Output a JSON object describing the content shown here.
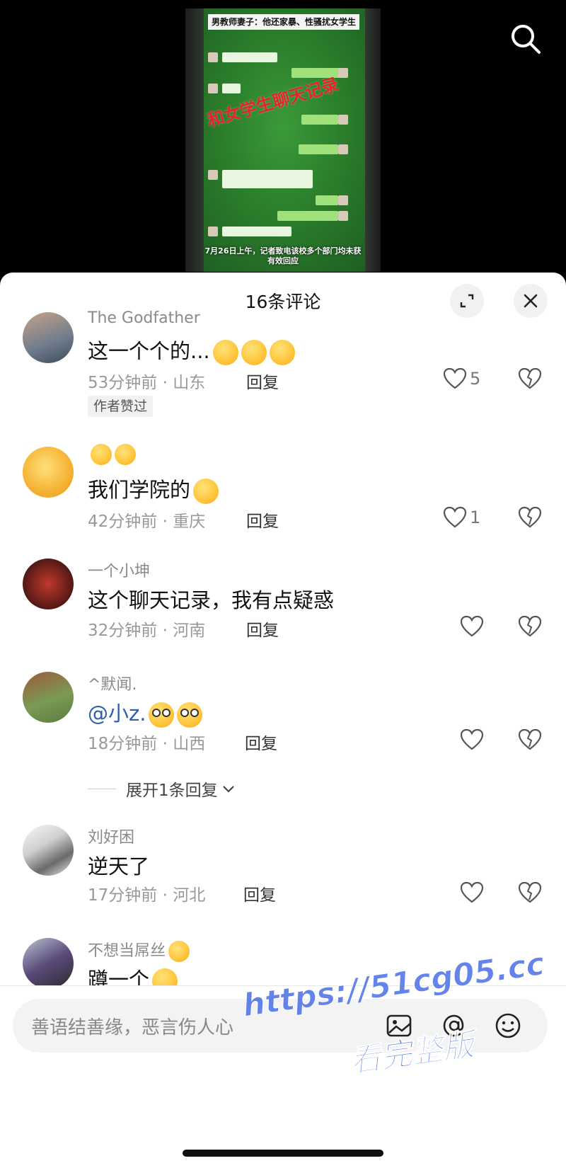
{
  "video": {
    "banner_title": "男教师妻子：他还家暴、性骚扰女学生",
    "overlay_text": "和女学生聊天记录",
    "caption_line1": "7月26日上午，记者致电该校多个部门均未获",
    "caption_line2": "有效回应"
  },
  "sheet": {
    "title": "16条评论"
  },
  "comments": [
    {
      "user": "The Godfather",
      "text": "这一个个的...",
      "time": "53分钟前",
      "location": "山东",
      "reply_label": "回复",
      "likes": "5",
      "badge": "作者赞过"
    },
    {
      "user": "",
      "user_prefix_emojis": "smile-emoji smile-emoji",
      "text": "我们学院的",
      "time": "42分钟前",
      "location": "重庆",
      "reply_label": "回复",
      "likes": "1"
    },
    {
      "user": "一个小坤",
      "text": "这个聊天记录，我有点疑惑",
      "time": "32分钟前",
      "location": "河南",
      "reply_label": "回复"
    },
    {
      "user": "^默闻.",
      "mention": "@小z.",
      "text": "",
      "time": "18分钟前",
      "location": "山西",
      "reply_label": "回复",
      "expand_label": "展开1条回复"
    },
    {
      "user": "刘好困",
      "text": "逆天了",
      "time": "17分钟前",
      "location": "河北",
      "reply_label": "回复"
    },
    {
      "user": "不想当屌丝",
      "text": "蹲一个"
    }
  ],
  "meta_separator": " · ",
  "input": {
    "placeholder": "善语结善缘，恶言伤人心"
  },
  "watermark": {
    "line1": "https://51cg05.cc",
    "line2": "看完整版"
  },
  "colors": {
    "mention": "#2f5fa8",
    "watermark": "#4a6fe8",
    "overlay_red": "#e2252b"
  }
}
